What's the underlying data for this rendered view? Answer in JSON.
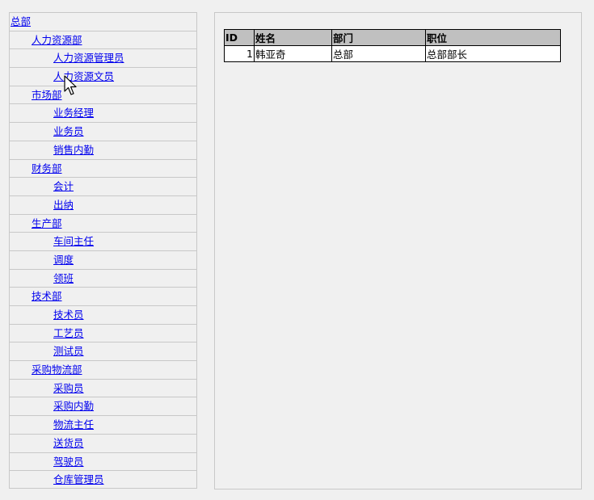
{
  "tree": {
    "items": [
      {
        "label": "总部",
        "level": 0
      },
      {
        "label": "人力资源部",
        "level": 1
      },
      {
        "label": "人力资源管理员",
        "level": 2
      },
      {
        "label": "人力资源文员",
        "level": 2
      },
      {
        "label": "市场部",
        "level": 1
      },
      {
        "label": "业务经理",
        "level": 2
      },
      {
        "label": "业务员",
        "level": 2
      },
      {
        "label": "销售内勤",
        "level": 2
      },
      {
        "label": "财务部",
        "level": 1
      },
      {
        "label": "会计",
        "level": 2
      },
      {
        "label": "出纳",
        "level": 2
      },
      {
        "label": "生产部",
        "level": 1
      },
      {
        "label": "车间主任",
        "level": 2
      },
      {
        "label": "调度",
        "level": 2
      },
      {
        "label": "领班",
        "level": 2
      },
      {
        "label": "技术部",
        "level": 1
      },
      {
        "label": "技术员",
        "level": 2
      },
      {
        "label": "工艺员",
        "level": 2
      },
      {
        "label": "测试员",
        "level": 2
      },
      {
        "label": "采购物流部",
        "level": 1
      },
      {
        "label": "采购员",
        "level": 2
      },
      {
        "label": "采购内勤",
        "level": 2
      },
      {
        "label": "物流主任",
        "level": 2
      },
      {
        "label": "送货员",
        "level": 2
      },
      {
        "label": "驾驶员",
        "level": 2
      },
      {
        "label": "仓库管理员",
        "level": 2
      }
    ]
  },
  "grid": {
    "headers": {
      "id": "ID",
      "name": "姓名",
      "dept": "部门",
      "position": "职位"
    },
    "rows": [
      {
        "id": "1",
        "name": "韩亚奇",
        "dept": "总部",
        "position": "总部部长"
      }
    ]
  },
  "icons": {
    "cursor": "mouse-pointer-icon"
  }
}
